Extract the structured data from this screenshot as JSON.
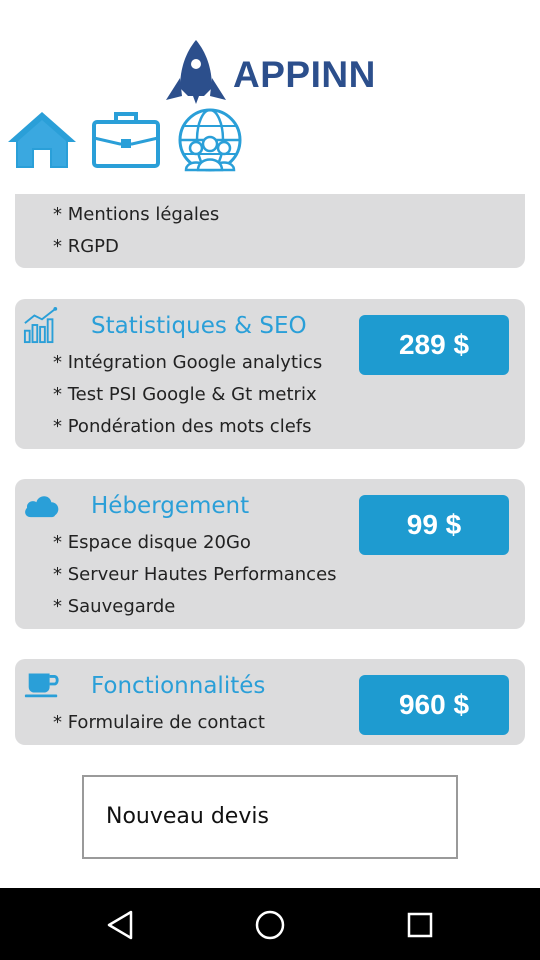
{
  "app": {
    "logo_text": "APPINN"
  },
  "nav_icons": [
    "home-icon",
    "briefcase-icon",
    "globe-team-icon"
  ],
  "cards": [
    {
      "items": [
        "* Mentions légales",
        "* RGPD"
      ]
    },
    {
      "icon": "chart-growth-icon",
      "title": "Statistiques & SEO",
      "price": "289 $",
      "items": [
        "* Intégration Google analytics",
        "* Test PSI Google & Gt metrix",
        "* Pondération des mots clefs"
      ]
    },
    {
      "icon": "cloud-icon",
      "title": "Hébergement",
      "price": "99 $",
      "items": [
        "* Espace disque 20Go",
        "* Serveur Hautes Performances",
        "* Sauvegarde"
      ]
    },
    {
      "icon": "coffee-cup-icon",
      "title": "Fonctionnalités",
      "price": "960 $",
      "items": [
        "* Formulaire de contact"
      ]
    }
  ],
  "new_quote_label": "Nouveau devis",
  "system_nav": [
    "back-icon",
    "home-circle-icon",
    "recents-icon"
  ],
  "colors": {
    "accent": "#1e9bd0",
    "title_blue": "#2a9fd8",
    "card_bg": "#dcdcdd",
    "logo_blue": "#2c4f8c"
  }
}
